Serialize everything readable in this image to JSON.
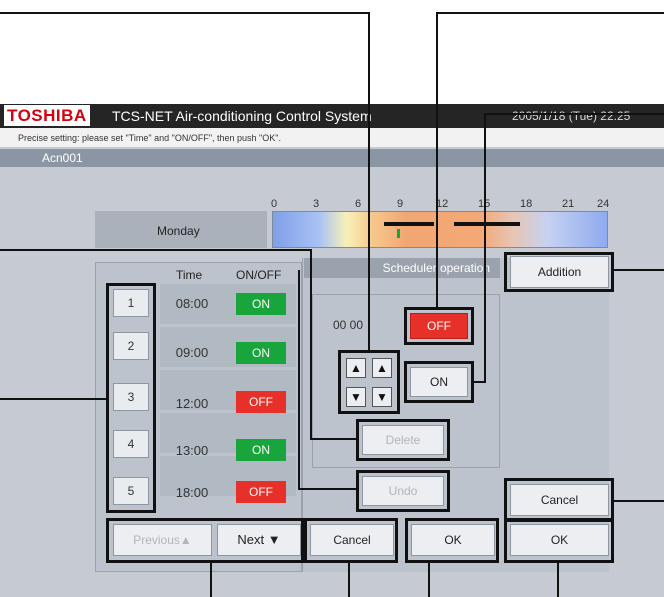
{
  "titlebar": {
    "brand": "TOSHIBA",
    "app_title": "TCS-NET Air-conditioning Control System",
    "datetime": "2005/1/18 (Tue) 22:25"
  },
  "hint": "Precise setting: please set \"Time\" and \"ON/OFF\", then push \"OK\".",
  "unit": "Acn001",
  "day": {
    "label": "Monday",
    "ticks": [
      "0",
      "3",
      "6",
      "9",
      "12",
      "15",
      "18",
      "21",
      "24"
    ]
  },
  "schedule": {
    "col_time": "Time",
    "col_onoff": "ON/OFF",
    "rows": [
      {
        "num": "1",
        "time": "08:00",
        "state": "ON"
      },
      {
        "num": "2",
        "time": "09:00",
        "state": "ON"
      },
      {
        "num": "3",
        "time": "12:00",
        "state": "OFF"
      },
      {
        "num": "4",
        "time": "13:00",
        "state": "ON"
      },
      {
        "num": "5",
        "time": "18:00",
        "state": "OFF"
      }
    ],
    "previous_label": "Previous▲",
    "next_label": "Next ▼"
  },
  "operation": {
    "header": "Scheduler operation",
    "time_value": "00 00",
    "off_label": "OFF",
    "on_label": "ON",
    "delete_label": "Delete",
    "undo_label": "Undo",
    "cancel_label": "Cancel",
    "ok_label": "OK"
  },
  "right": {
    "addition_label": "Addition",
    "cancel_label": "Cancel",
    "ok_label": "OK"
  },
  "colors": {
    "on": "#18a53c",
    "off": "#e8302b",
    "brand": "#d7000f"
  }
}
